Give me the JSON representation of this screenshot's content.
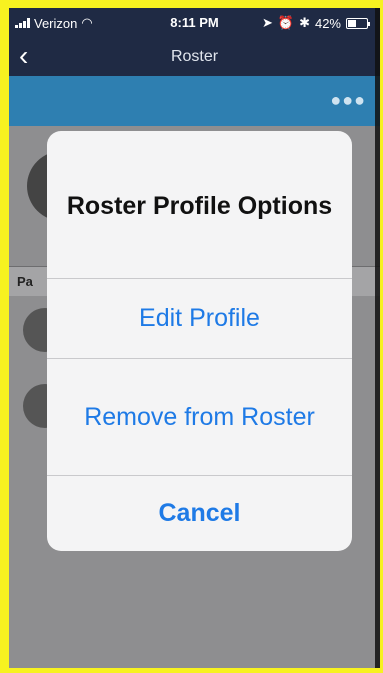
{
  "status_bar": {
    "carrier": "Verizon",
    "time": "8:11 PM",
    "battery": "42%",
    "battery_level": 0.42
  },
  "nav": {
    "title": "Roster",
    "back_icon": "chevron-left-icon"
  },
  "toolbar": {
    "more_icon": "ellipsis-icon"
  },
  "background": {
    "section_label": "Pa"
  },
  "dialog": {
    "title": "Roster Profile Options",
    "actions": {
      "edit": "Edit Profile",
      "remove": "Remove from Roster",
      "cancel": "Cancel"
    }
  },
  "colors": {
    "accent": "#1e7ae6",
    "navbar": "#1f2a44",
    "band": "#2e7fb1",
    "border_highlight": "#f7f220"
  }
}
